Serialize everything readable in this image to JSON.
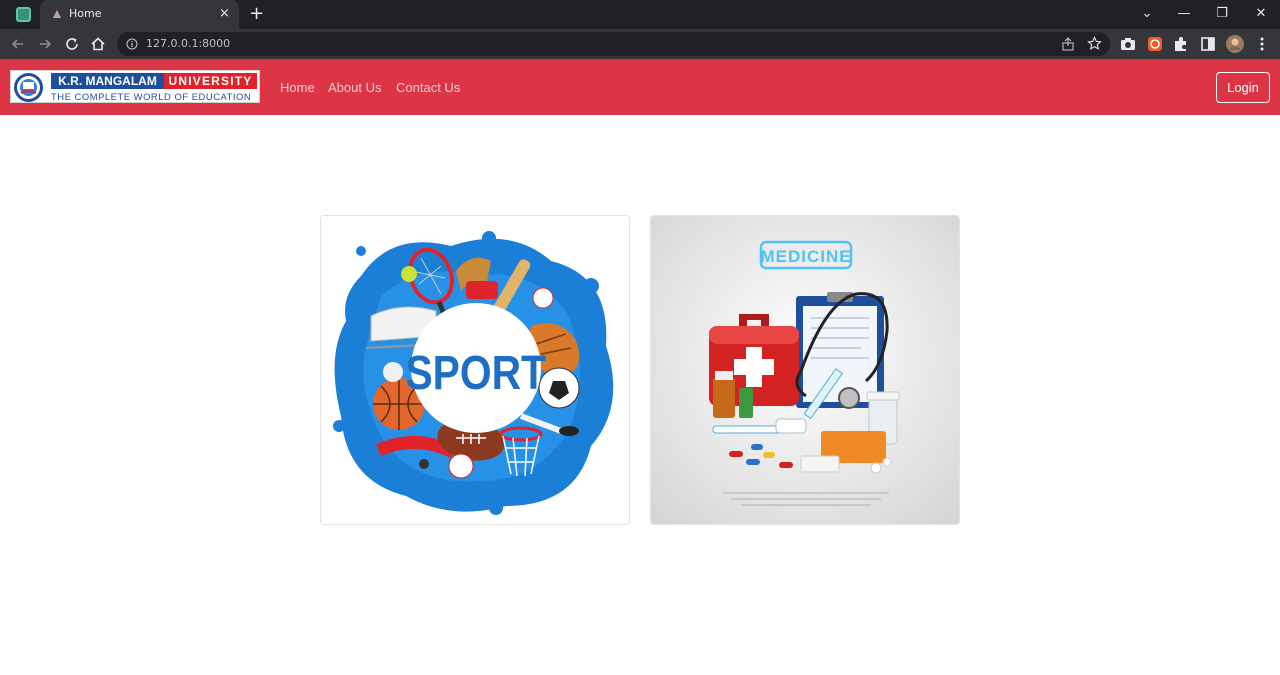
{
  "browser": {
    "tab_title": "Home",
    "tab_close": "×",
    "new_tab": "+",
    "url": "127.0.0.1:8000",
    "window_controls": {
      "menu": "⌄",
      "minimize": "—",
      "restore": "❐",
      "close": "✕"
    }
  },
  "brand": {
    "name": "K.R. MANGALAM",
    "name_suffix": "UNIVERSITY",
    "tagline": "THE COMPLETE WORLD OF EDUCATION",
    "primary_color": "#dc3545"
  },
  "nav": {
    "links": [
      {
        "label": "Home"
      },
      {
        "label": "About Us"
      },
      {
        "label": "Contact Us"
      }
    ],
    "login": "Login"
  },
  "cards": [
    {
      "label": "SPORT",
      "icon": "sports-collage"
    },
    {
      "label": "MEDICINE",
      "icon": "medical-kit-collage"
    }
  ]
}
